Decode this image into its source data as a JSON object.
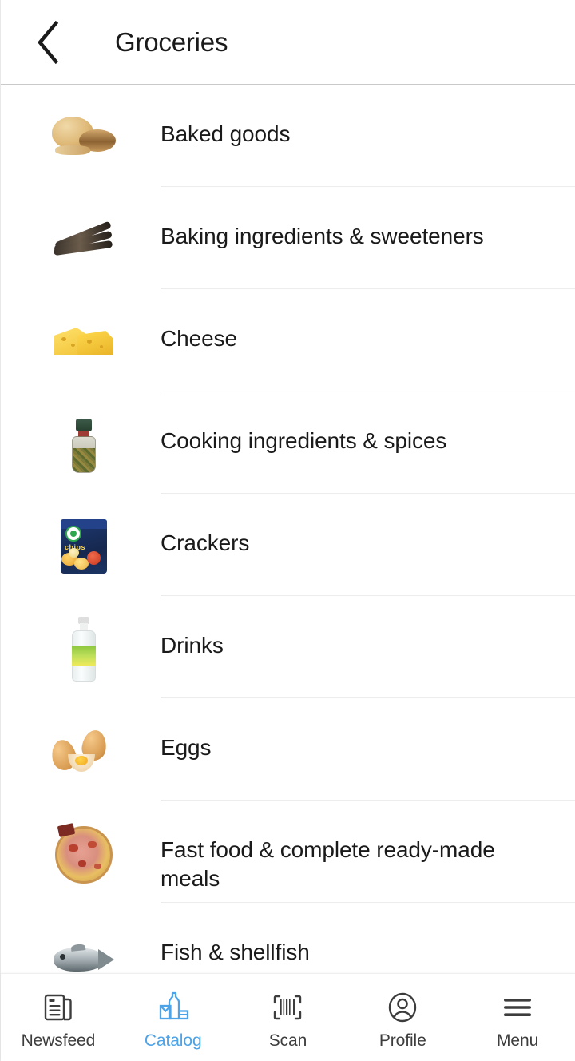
{
  "header": {
    "title": "Groceries",
    "back_icon": "chevron-left-icon"
  },
  "catalog": {
    "items": [
      {
        "label": "Baked goods",
        "thumb": "bread-rolls-image"
      },
      {
        "label": "Baking ingredients & sweeteners",
        "thumb": "vanilla-pods-image"
      },
      {
        "label": "Cheese",
        "thumb": "cheese-wedges-image"
      },
      {
        "label": "Cooking ingredients & spices",
        "thumb": "spice-grinder-image"
      },
      {
        "label": "Crackers",
        "thumb": "chips-bag-image"
      },
      {
        "label": "Drinks",
        "thumb": "water-bottle-image"
      },
      {
        "label": "Eggs",
        "thumb": "eggs-image"
      },
      {
        "label": "Fast food & complete ready-made meals",
        "thumb": "pizza-image"
      },
      {
        "label": "Fish & shellfish",
        "thumb": "fish-image"
      }
    ]
  },
  "bottom_nav": {
    "active": "Catalog",
    "active_color": "#4da3e8",
    "inactive_color": "#3d3d3d",
    "items": [
      {
        "label": "Newsfeed",
        "icon": "newspaper-icon"
      },
      {
        "label": "Catalog",
        "icon": "bottle-products-icon"
      },
      {
        "label": "Scan",
        "icon": "barcode-scan-icon"
      },
      {
        "label": "Profile",
        "icon": "user-circle-icon"
      },
      {
        "label": "Menu",
        "icon": "hamburger-menu-icon"
      }
    ]
  }
}
